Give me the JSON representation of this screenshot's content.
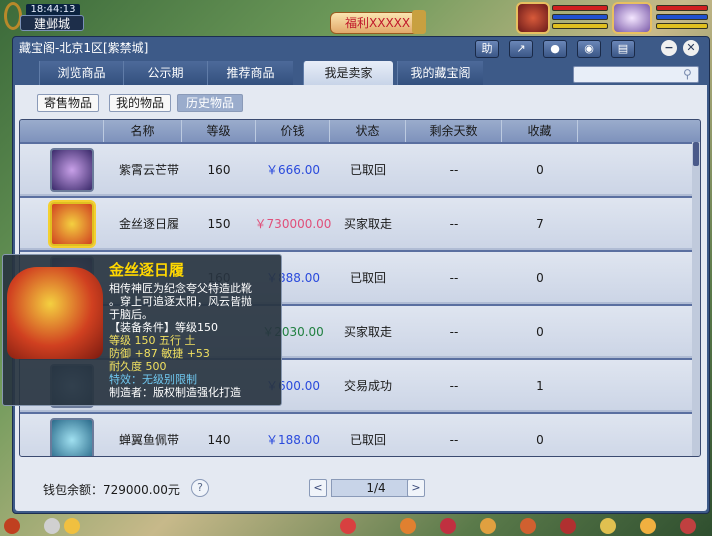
{
  "hud": {
    "time": "18:44:13",
    "city": "建邺城",
    "welfare_label": "福利XXXXX"
  },
  "window": {
    "title": "藏宝阁-北京1区[紫禁城]",
    "buttons": [
      "助"
    ],
    "tabs": [
      {
        "label": "浏览商品"
      },
      {
        "label": "公示期"
      },
      {
        "label": "推荐商品"
      },
      {
        "label": "我是卖家"
      },
      {
        "label": "我的藏宝阁"
      }
    ],
    "search_placeholder": ""
  },
  "subtabs": [
    {
      "label": "寄售物品"
    },
    {
      "label": "我的物品"
    },
    {
      "label": "历史物品"
    }
  ],
  "table": {
    "columns": [
      "名称",
      "等级",
      "价钱",
      "状态",
      "剩余天数",
      "收藏"
    ],
    "rows": [
      {
        "name": "紫霄云芒带",
        "level": "160",
        "price": "￥666.00",
        "status": "已取回",
        "days": "--",
        "fav": "0"
      },
      {
        "name": "金丝逐日履",
        "level": "150",
        "price": "￥730000.00",
        "status": "买家取走",
        "days": "--",
        "fav": "7"
      },
      {
        "name": "",
        "level": "160",
        "price": "￥888.00",
        "status": "已取回",
        "days": "--",
        "fav": "0"
      },
      {
        "name": "",
        "level": "",
        "price": "￥2030.00",
        "status": "买家取走",
        "days": "--",
        "fav": "0"
      },
      {
        "name": "",
        "level": "",
        "price": "￥600.00",
        "status": "交易成功",
        "days": "--",
        "fav": "1"
      },
      {
        "name": "蝉翼鱼佩带",
        "level": "140",
        "price": "￥188.00",
        "status": "已取回",
        "days": "--",
        "fav": "0"
      }
    ]
  },
  "footer": {
    "wallet": "钱包余额：729000.00元",
    "help": "?",
    "prev": "<",
    "page": "1/4",
    "next": ">"
  },
  "tooltip": {
    "title": "金丝逐日履",
    "desc1": "相传神匠为纪念夸父特造此靴",
    "desc2": "。穿上可追逐太阳，风云皆抛",
    "desc3": "于脑后。",
    "requirement": "【装备条件】等级150",
    "stat1": "等级 150  五行 土",
    "stat2": "防御 +87  敏捷 +53",
    "stat3": "耐久度 500",
    "special": "特效：无级别限制",
    "maker": "制造者：版权制造强化打造"
  },
  "colors": {
    "window_bg": "#3d5a88",
    "content_bg": "#e4e9f2",
    "price_blue": "#2a4adc",
    "price_pink": "#e0507a",
    "tooltip_title": "#ffd700"
  }
}
